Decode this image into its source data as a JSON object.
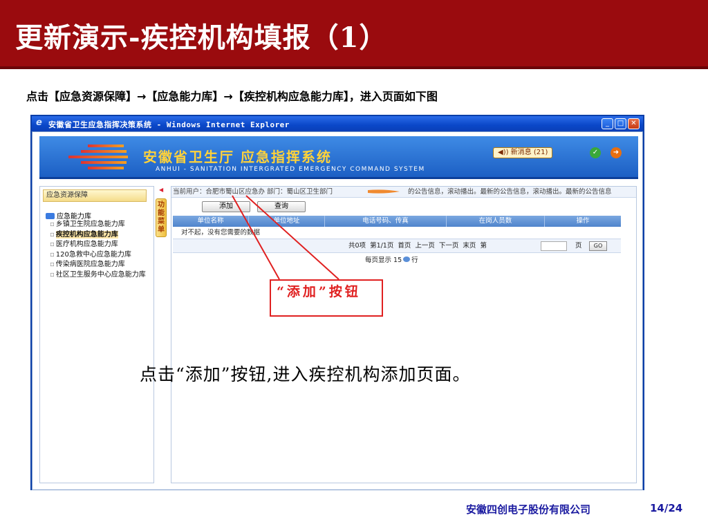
{
  "slide": {
    "title": "更新演示-疾控机构填报（1）",
    "instruction": "点击【应急资源保障】→【应急能力库】→【疾控机构应急能力库】，进入页面如下图",
    "caption": "点击“添加”按钮,进入疾控机构添加页面。",
    "footer_company": "安徽四创电子股份有限公司",
    "footer_page": "14/24"
  },
  "browser": {
    "title": "安徽省卫生应急指挥决策系统 - Windows Internet Explorer",
    "logo_glyph": "e",
    "minimize_glyph": "_",
    "maximize_glyph": "□",
    "close_glyph": "✕"
  },
  "app": {
    "banner_title": "安徽省卫生厅   应急指挥系统",
    "banner_subtitle": "ANHUI - SANITATION INTERGRATED EMERGENCY COMMAND SYSTEM",
    "news_label": "◀)) 新消息 (21)",
    "icons": [
      "check-icon",
      "exit-icon"
    ]
  },
  "sidebar": {
    "header": "应急资源保障",
    "root": "应急能力库",
    "items": [
      {
        "label": "乡镇卫生院应急能力库",
        "active": false
      },
      {
        "label": "疾控机构应急能力库",
        "active": true
      },
      {
        "label": "医疗机构应急能力库",
        "active": false
      },
      {
        "label": "120急救中心应急能力库",
        "active": false
      },
      {
        "label": "传染病医院应急能力库",
        "active": false
      },
      {
        "label": "社区卫生服务中心应急能力库",
        "active": false
      }
    ],
    "func_tab": "功能菜单"
  },
  "main": {
    "user_info": "当前用户：合肥市蜀山区应急办   部门：蜀山区卫生部门",
    "marquee": "的公告信息，滚动播出。最新的公告信息，滚动播出。最新的公告信息",
    "add_label": "添加",
    "query_label": "查询",
    "columns": [
      "单位名称",
      "单位地址",
      "电话号码、传真",
      "在岗人员数",
      "操作"
    ],
    "empty_text": "对不起，没有您需要的数据",
    "pager_text": "共0项   第1/1页   首页   上一页   下一页   末页   第",
    "page_unit": "页",
    "go_label": "GO",
    "perpage_prefix": "每页显示 15",
    "perpage_suffix": "行"
  },
  "annotation": {
    "text": "“添加”按钮",
    "color": "#e02020"
  },
  "colors": {
    "title_bar": "#9a0b0e",
    "banner_blue": "#1c5fc4",
    "banner_title": "#ffd23a",
    "footer_text": "#1a1aa0"
  }
}
